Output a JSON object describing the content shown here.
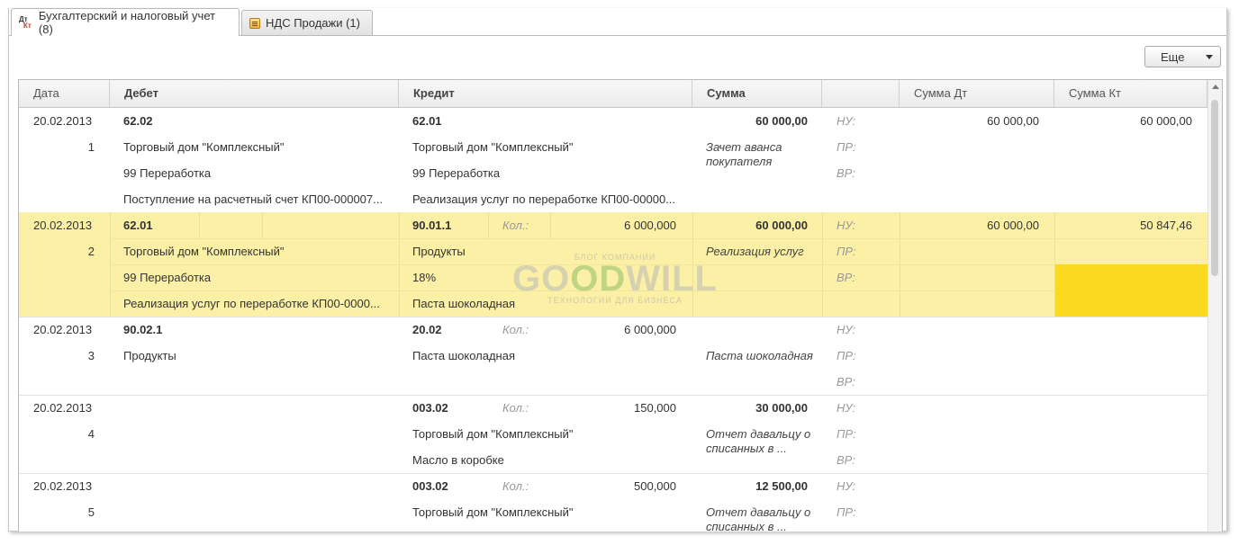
{
  "tabs": [
    {
      "label": "Бухгалтерский и налоговый учет (8)",
      "icon": "dt-kt-icon",
      "icon_text_a": "Дт",
      "icon_text_b": "Кт"
    },
    {
      "label": "НДС Продажи (1)",
      "icon": "document-icon"
    }
  ],
  "toolbar": {
    "more_label": "Еще"
  },
  "columns": {
    "date": "Дата",
    "debit": "Дебет",
    "credit": "Кредит",
    "sum": "Сумма",
    "blank": "",
    "sum_dt": "Сумма Дт",
    "sum_kt": "Сумма Кт"
  },
  "labels": {
    "nu": "НУ:",
    "pr": "ПР:",
    "vr": "ВР:",
    "qty": "Кол.:"
  },
  "watermark": {
    "top": "БЛОГ КОМПАНИИ",
    "main_a": "GO",
    "main_b": "OD",
    "main_c": "WILL",
    "bottom": "ТЕХНОЛОГИИ ДЛЯ БИЗНЕСА"
  },
  "entries": [
    {
      "date": "20.02.2013",
      "num": "1",
      "debit": [
        "62.02",
        "Торговый дом \"Комплексный\"",
        "99 Переработка",
        "Поступление на расчетный счет КП00-000007..."
      ],
      "credit": [
        "62.01",
        "Торговый дом \"Комплексный\"",
        "99 Переработка",
        "Реализация услуг по переработке КП00-00000..."
      ],
      "credit_qty": "",
      "sum": "60 000,00",
      "content": "Зачет аванса покупателя",
      "sum_dt": "60 000,00",
      "sum_kt": "60 000,00"
    },
    {
      "date": "20.02.2013",
      "num": "2",
      "debit": [
        "62.01",
        "Торговый дом \"Комплексный\"",
        "99 Переработка",
        "Реализация услуг по переработке КП00-0000..."
      ],
      "credit": [
        "90.01.1",
        "Продукты",
        "18%",
        "Паста шоколадная"
      ],
      "credit_qty": "6 000,000",
      "sum": "60 000,00",
      "content": "Реализация услуг",
      "sum_dt": "60 000,00",
      "sum_kt": "50 847,46"
    },
    {
      "date": "20.02.2013",
      "num": "3",
      "debit": [
        "90.02.1",
        "Продукты"
      ],
      "credit": [
        "20.02",
        "Паста шоколадная"
      ],
      "credit_qty": "6 000,000",
      "sum": "",
      "content": "Паста шоколадная",
      "sum_dt": "",
      "sum_kt": ""
    },
    {
      "date": "20.02.2013",
      "num": "4",
      "debit": [],
      "credit": [
        "003.02",
        "Торговый дом \"Комплексный\"",
        "Масло в коробке"
      ],
      "credit_qty": "150,000",
      "sum": "30 000,00",
      "content": "Отчет давальцу о списанных в ...",
      "sum_dt": "",
      "sum_kt": ""
    },
    {
      "date": "20.02.2013",
      "num": "5",
      "debit": [],
      "credit": [
        "003.02",
        "Торговый дом \"Комплексный\""
      ],
      "credit_qty": "500,000",
      "sum": "12 500,00",
      "content": "Отчет давальцу о списанных в ...",
      "sum_dt": "",
      "sum_kt": ""
    }
  ]
}
